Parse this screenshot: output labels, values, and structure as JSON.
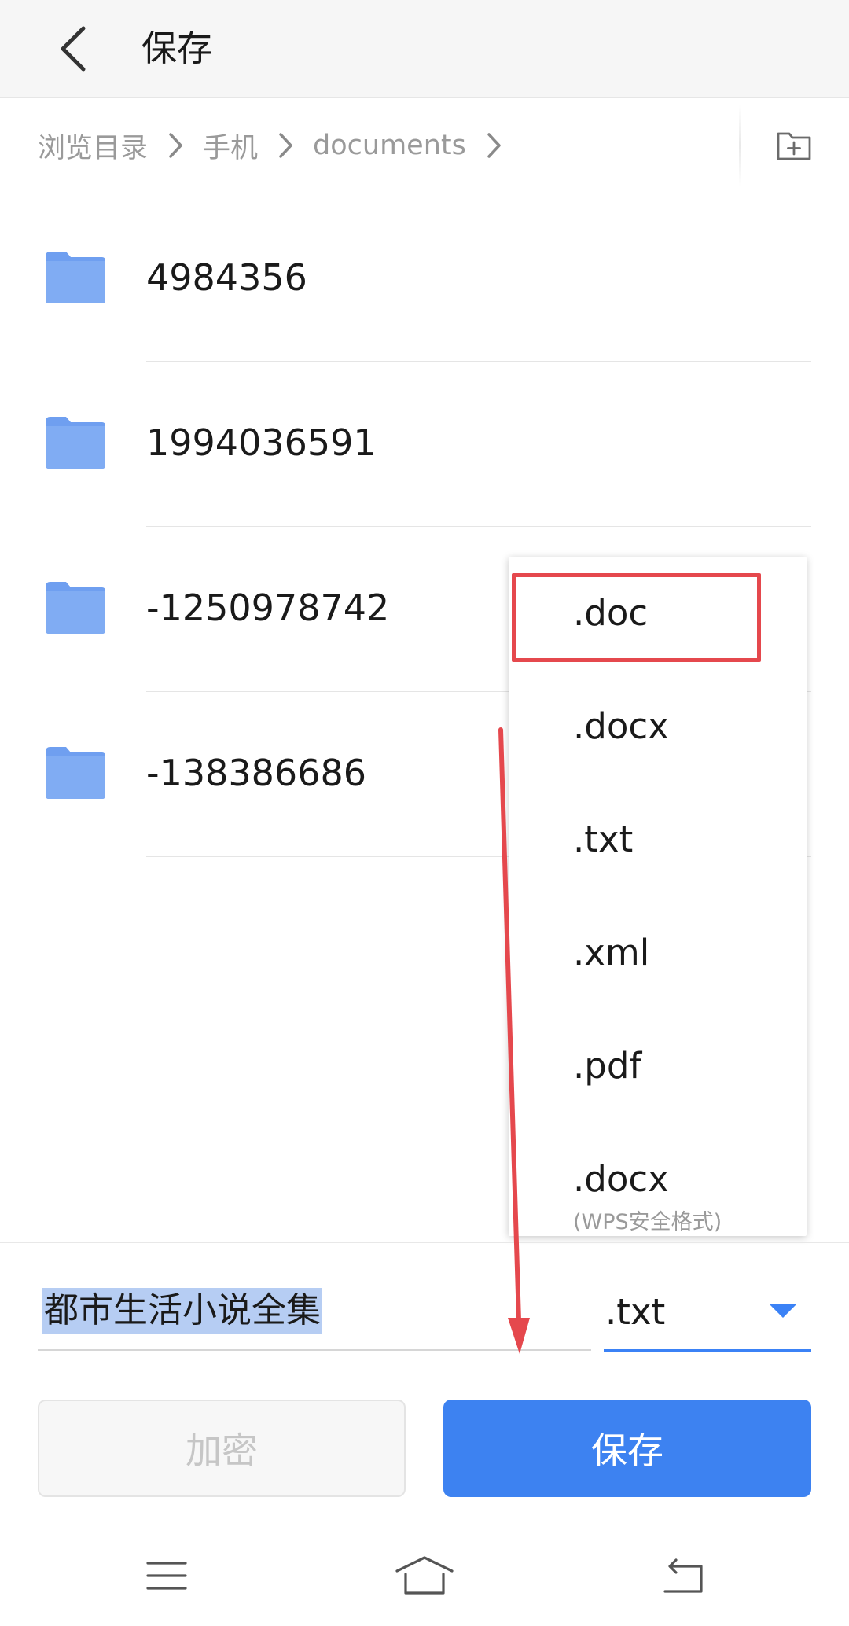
{
  "header": {
    "title": "保存",
    "back_icon": "chevron-left-icon"
  },
  "breadcrumb": {
    "items": [
      "浏览目录",
      "手机",
      "documents"
    ],
    "new_folder_icon": "new-folder-icon"
  },
  "folders": [
    {
      "name": "4984356"
    },
    {
      "name": "1994036591"
    },
    {
      "name": "-1250978742"
    },
    {
      "name": "-138386686"
    }
  ],
  "format_menu": {
    "options": [
      {
        "label": ".doc",
        "highlighted": true
      },
      {
        "label": ".docx"
      },
      {
        "label": ".txt"
      },
      {
        "label": ".xml"
      },
      {
        "label": ".pdf"
      },
      {
        "label": ".docx",
        "sublabel": "(WPS安全格式)"
      }
    ]
  },
  "filename": {
    "value": "都市生活小说全集"
  },
  "format_select": {
    "value": ".txt"
  },
  "buttons": {
    "encrypt": "加密",
    "save": "保存"
  },
  "navbar": {
    "icons": [
      "menu-icon",
      "home-icon",
      "back-icon"
    ]
  },
  "colors": {
    "accent": "#3d82f1",
    "annotation": "#e5484d",
    "folder": "#6f9ff0"
  }
}
